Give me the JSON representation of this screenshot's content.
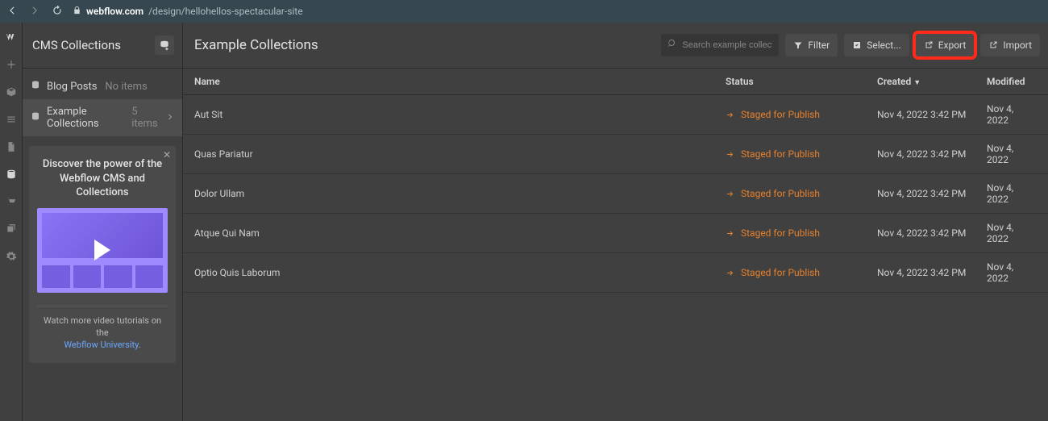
{
  "browser": {
    "host": "webflow.com",
    "path": "/design/hellohellos-spectacular-site"
  },
  "left": {
    "title": "CMS Collections",
    "items": [
      {
        "label": "Blog Posts",
        "count": "No items",
        "active": false
      },
      {
        "label": "Example Collections",
        "count": "5 items",
        "active": true
      }
    ],
    "promo_title": "Discover the power of the Webflow CMS and Collections",
    "promo_line": "Watch more video tutorials on the",
    "promo_link": "Webflow University"
  },
  "main": {
    "title": "Example Collections",
    "search_placeholder": "Search example collections",
    "buttons": {
      "filter": "Filter",
      "select": "Select...",
      "export": "Export",
      "import": "Import"
    },
    "columns": {
      "name": "Name",
      "status": "Status",
      "created": "Created",
      "modified": "Modified"
    },
    "status_label": "Staged for Publish",
    "rows": [
      {
        "name": "Aut Sit",
        "created": "Nov 4, 2022 3:42 PM",
        "modified": "Nov 4, 2022"
      },
      {
        "name": "Quas Pariatur",
        "created": "Nov 4, 2022 3:42 PM",
        "modified": "Nov 4, 2022"
      },
      {
        "name": "Dolor Ullam",
        "created": "Nov 4, 2022 3:42 PM",
        "modified": "Nov 4, 2022"
      },
      {
        "name": "Atque Qui Nam",
        "created": "Nov 4, 2022 3:42 PM",
        "modified": "Nov 4, 2022"
      },
      {
        "name": "Optio Quis Laborum",
        "created": "Nov 4, 2022 3:42 PM",
        "modified": "Nov 4, 2022"
      }
    ]
  }
}
